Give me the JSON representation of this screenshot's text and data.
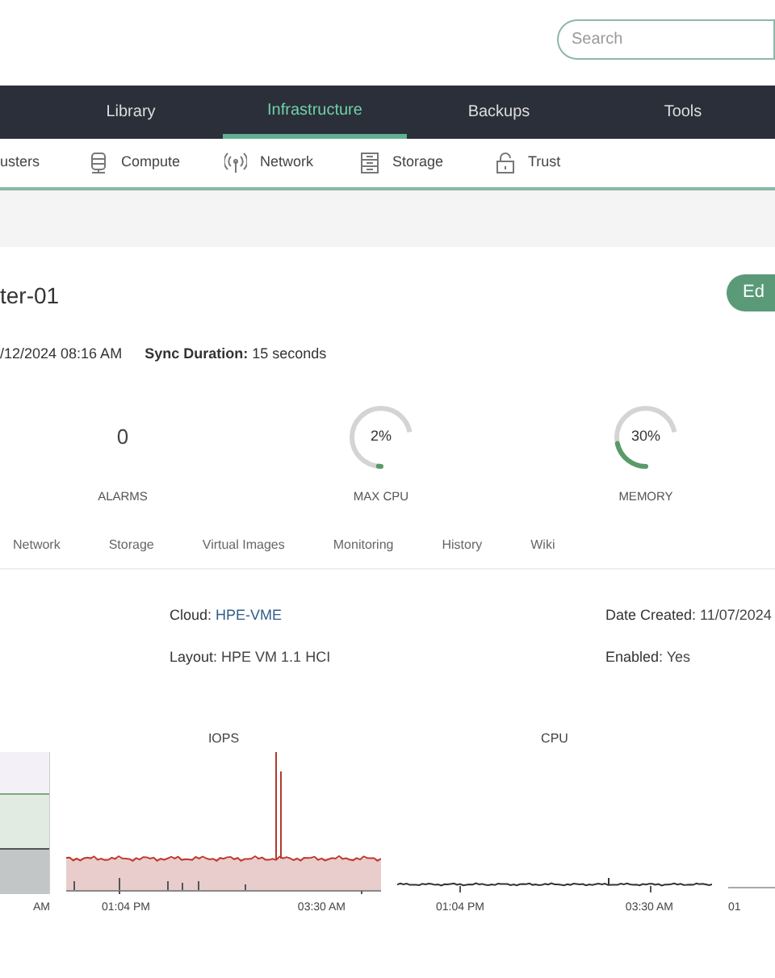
{
  "search": {
    "placeholder": "Search"
  },
  "nav": [
    {
      "label": "Library",
      "selected": false
    },
    {
      "label": "Infrastructure",
      "selected": true
    },
    {
      "label": "Backups",
      "selected": false
    },
    {
      "label": "Tools",
      "selected": false
    }
  ],
  "subnav": [
    {
      "label": "usters",
      "kind": "plain"
    },
    {
      "label": "Compute",
      "kind": "compute"
    },
    {
      "label": "Network",
      "kind": "network"
    },
    {
      "label": "Storage",
      "kind": "storage"
    },
    {
      "label": "Trust",
      "kind": "trust"
    }
  ],
  "cluster": {
    "title": "ter-01",
    "edit_button": "Ed",
    "last_sync": "/12/2024 08:16 AM",
    "sync_label": "Sync Duration:",
    "sync_value": "15 seconds"
  },
  "stats": [
    {
      "kind": "count",
      "value": "0",
      "label": "ALARMS"
    },
    {
      "kind": "gauge",
      "value": "2%",
      "level": 0.02,
      "label": "MAX CPU"
    },
    {
      "kind": "gauge",
      "value": "30%",
      "level": 0.3,
      "label": "MEMORY"
    }
  ],
  "tabs": [
    {
      "label": "Network",
      "selected": false
    },
    {
      "label": "Storage",
      "selected": false
    },
    {
      "label": "Virtual Images",
      "selected": false
    },
    {
      "label": "Monitoring",
      "selected": false
    },
    {
      "label": "History",
      "selected": false
    },
    {
      "label": "Wiki",
      "selected": false
    }
  ],
  "details": [
    {
      "label": "Cloud:",
      "value": "HPE-VME",
      "kind": "link"
    },
    {
      "label": "Date Created:",
      "value": "11/07/2024",
      "kind": "text"
    },
    {
      "label": "Layout:",
      "value": "HPE VM 1.1 HCI",
      "kind": "text"
    },
    {
      "label": "Enabled:",
      "value": "Yes",
      "kind": "text"
    }
  ],
  "charts": [
    {
      "kind": "stacked",
      "xticks": [
        "AM"
      ]
    },
    {
      "kind": "iops",
      "title": "IOPS",
      "xticks": [
        "01:04 PM",
        "03:30 AM"
      ]
    },
    {
      "kind": "cpu",
      "title": "CPU",
      "xticks": [
        "01:04 PM",
        "03:30 AM"
      ]
    },
    {
      "kind": "partial",
      "xticks": [
        "01"
      ]
    }
  ]
}
